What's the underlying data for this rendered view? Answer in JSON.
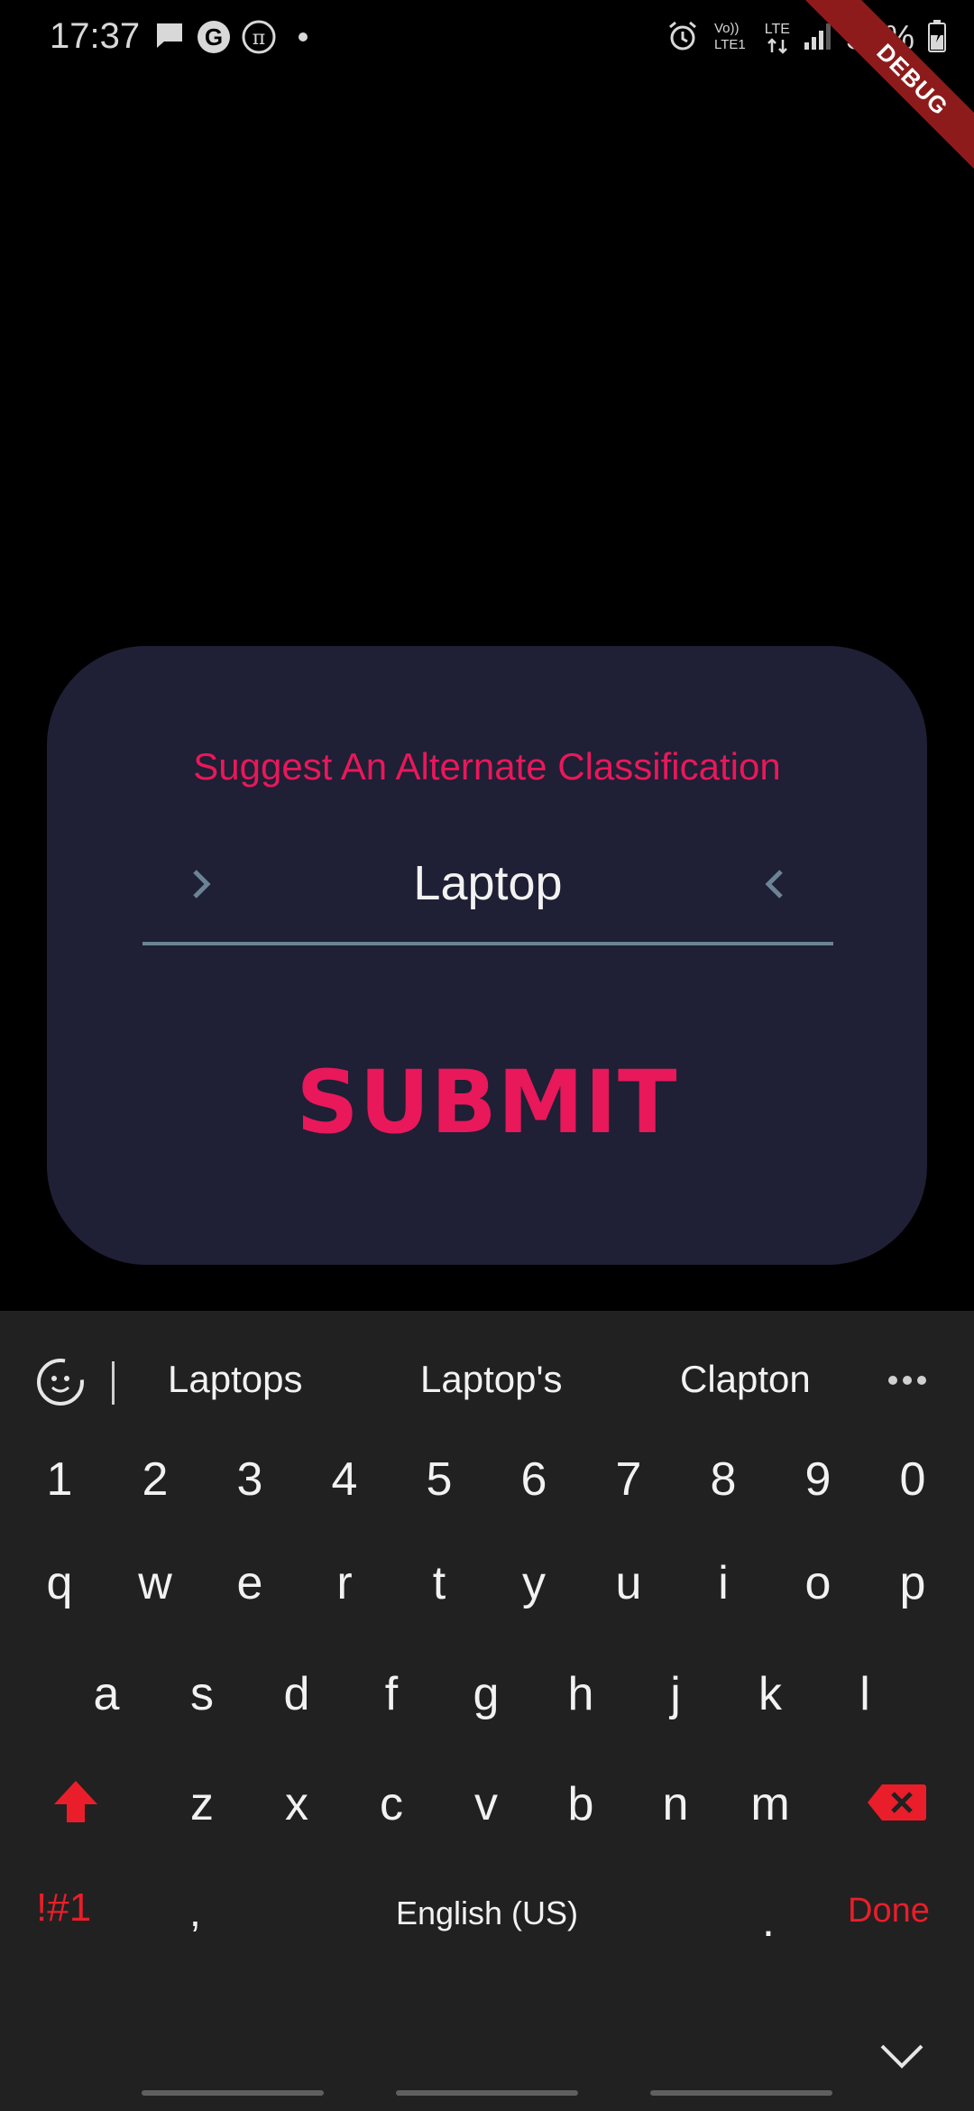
{
  "status_bar": {
    "time": "17:37",
    "battery": "52%",
    "network": "LTE",
    "icons": [
      "chat-icon",
      "google-icon",
      "pi-icon",
      "dot-icon",
      "alarm-icon",
      "volte-icon",
      "signal-icon",
      "battery-icon"
    ]
  },
  "debug_banner": "DEBUG",
  "dialog": {
    "title": "Suggest An Alternate Classification",
    "value": "Laptop",
    "submit_label": "SUBMIT",
    "colors": {
      "accent": "#e8185a",
      "card": "#1f1f35",
      "underline": "#6a8496"
    }
  },
  "keyboard": {
    "suggestions": [
      "Laptops",
      "Laptop's",
      "Clapton"
    ],
    "number_row": [
      "1",
      "2",
      "3",
      "4",
      "5",
      "6",
      "7",
      "8",
      "9",
      "0"
    ],
    "row1": [
      "q",
      "w",
      "e",
      "r",
      "t",
      "y",
      "u",
      "i",
      "o",
      "p"
    ],
    "row2": [
      "a",
      "s",
      "d",
      "f",
      "g",
      "h",
      "j",
      "k",
      "l"
    ],
    "row3": [
      "z",
      "x",
      "c",
      "v",
      "b",
      "n",
      "m"
    ],
    "symbols_label": "!#1",
    "comma": ",",
    "space_label": "English (US)",
    "period": ".",
    "done_label": "Done"
  }
}
